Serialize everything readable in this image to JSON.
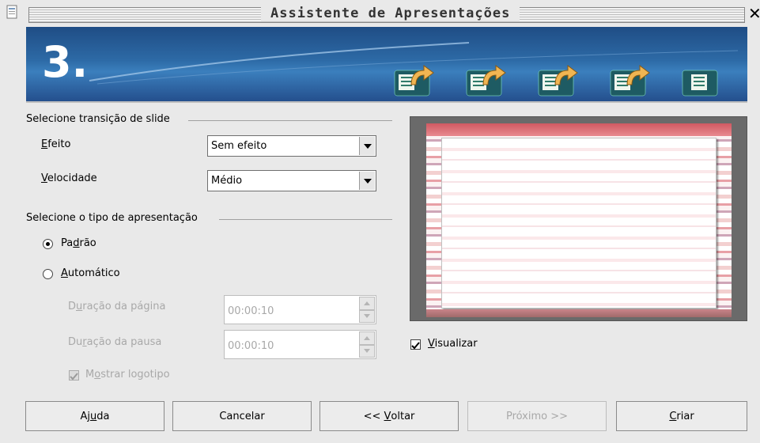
{
  "window": {
    "title": "Assistente de Apresentações",
    "close_glyph": "✕"
  },
  "banner": {
    "step": "3."
  },
  "transition": {
    "section_title": "Selecione transição de slide",
    "effect_label_pre": "",
    "effect_label_mnemonic": "E",
    "effect_label_post": "feito",
    "effect_value": "Sem efeito",
    "speed_label_mnemonic": "V",
    "speed_label_post": "elocidade",
    "speed_value": "Médio"
  },
  "presentation_type": {
    "section_title": "Selecione o tipo de apresentação",
    "standard_pre": "Pa",
    "standard_mnemonic": "d",
    "standard_post": "rão",
    "standard_selected": true,
    "automatic_mnemonic": "A",
    "automatic_post": "utomático",
    "automatic_selected": false,
    "page_duration_pre": "D",
    "page_duration_mnemonic": "u",
    "page_duration_post": "ração da página",
    "page_duration_value": "00:00:10",
    "pause_duration_pre": "Du",
    "pause_duration_mnemonic": "r",
    "pause_duration_post": "ação da pausa",
    "pause_duration_value": "00:00:10",
    "show_logo_pre": "M",
    "show_logo_mnemonic": "o",
    "show_logo_post": "strar logotipo",
    "show_logo_checked": true
  },
  "preview": {
    "label_mnemonic": "V",
    "label_post": "isualizar",
    "checked": true
  },
  "buttons": {
    "help_pre": "Aj",
    "help_mnemonic": "u",
    "help_post": "da",
    "cancel": "Cancelar",
    "back_pre": "<< ",
    "back_mnemonic": "V",
    "back_post": "oltar",
    "next": "Próximo >>",
    "create_mnemonic": "C",
    "create_post": "riar"
  },
  "colors": {
    "banner_blue": "#2d6aa6",
    "arrow_gold": "#f0b552",
    "icon_green": "#2f7a6a",
    "slide_pink": "#d05a62"
  },
  "icons": {
    "window_icon": "presentation-document-icon",
    "close": "close-icon",
    "dropdown": "chevron-down-icon",
    "step_pages": "page-with-arrow-icon",
    "last_step": "page-icon"
  }
}
